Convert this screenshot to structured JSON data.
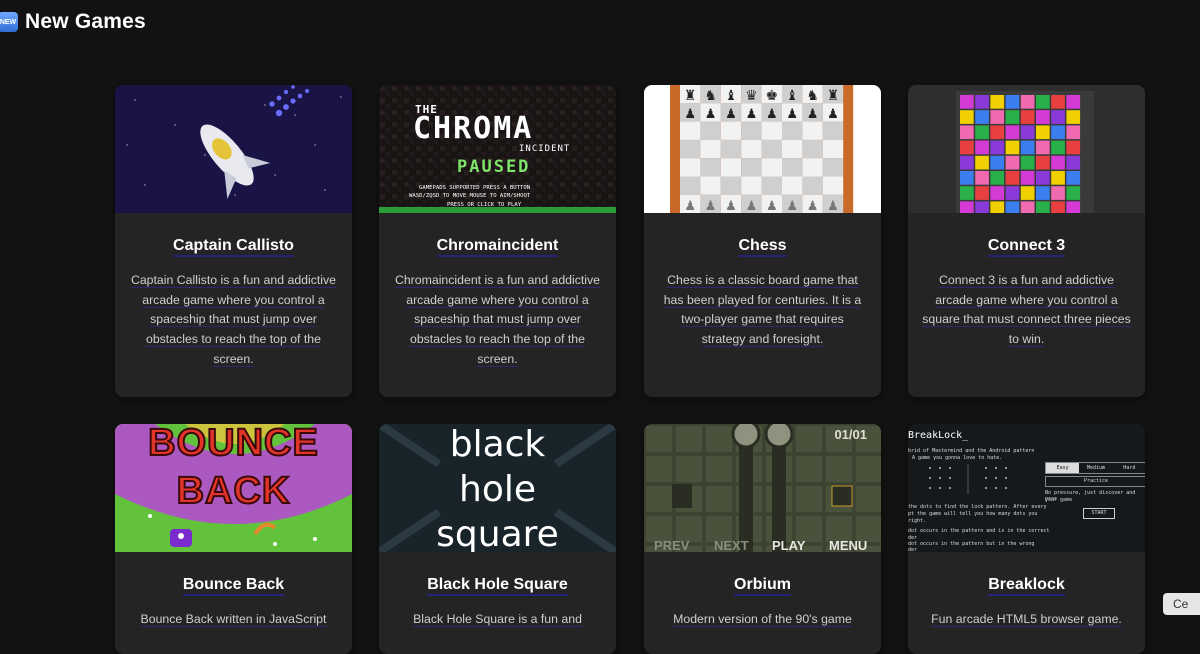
{
  "header": {
    "badge": "NEW",
    "title": "New Games"
  },
  "cards": [
    {
      "title": "Captain Callisto",
      "desc": "Captain Callisto is a fun and addictive arcade game where you control a spaceship that must jump over obstacles to reach the top of the screen."
    },
    {
      "title": "Chromaincident",
      "desc": "Chromaincident is a fun and addictive arcade game where you control a spaceship that must jump over obstacles to reach the top of the screen.",
      "thumb": {
        "line1": "THE",
        "line2": "CHROMA",
        "line3": "INCIDENT",
        "line4": "PAUSED",
        "line5": "GAMEPADS SUPPORTED PRESS A BUTTON",
        "line6": "WASD/ZQSD TO MOVE   MOUSE TO AIM/SHOOT",
        "line7": "PRESS OR CLICK TO PLAY"
      }
    },
    {
      "title": "Chess",
      "desc": "Chess is a classic board game that has been played for centuries. It is a two-player game that requires strategy and foresight."
    },
    {
      "title": "Connect 3",
      "desc": "Connect 3 is a fun and addictive arcade game where you control a square that must connect three pieces to win."
    },
    {
      "title": "Bounce Back",
      "desc": "Bounce Back written in JavaScript",
      "thumb": {
        "line1": "BOUNCE",
        "line2": "BACK"
      }
    },
    {
      "title": "Black Hole Square",
      "desc": "Black Hole Square is a fun and",
      "thumb": {
        "line1": "black",
        "line2": "hole",
        "line3": "square"
      }
    },
    {
      "title": "Orbium",
      "desc": "Modern version of the 90's game",
      "thumb": {
        "counter": "01/01",
        "prev": "PREV",
        "next": "NEXT",
        "play": "PLAY",
        "menu": "MENU"
      }
    },
    {
      "title": "Breaklock",
      "desc": "Fun arcade HTML5 browser game.",
      "thumb": {
        "logo": "BreakLock_",
        "intro1": "brid of Mastermind and the Android pattern",
        "intro2": "A game you gonna love to hate.",
        "tab1": "Easy",
        "tab2": "Medium",
        "tab3": "Hard",
        "practice": "Practice",
        "hint1": "No pressure, just discover and prac",
        "hint2": "your game",
        "start": "START",
        "rule1": "the dots to find the lock pattern. After every",
        "rule2": "pt the game will tell you how many dots you",
        "rule3": "right.",
        "rule4": "dot occurs in the pattern and is in the correct",
        "rule5": "der",
        "rule6": "dot occurs in the pattern but in the wrong",
        "rule7": "der"
      }
    }
  ],
  "side_button": "Ce"
}
